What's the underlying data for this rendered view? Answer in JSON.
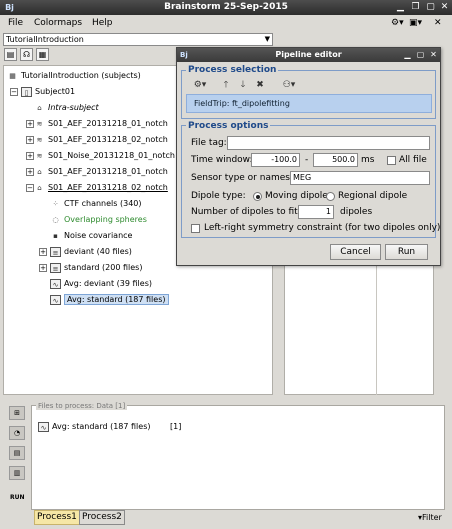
{
  "window": {
    "title": "Brainstorm 25-Sep-2015",
    "app_icon": "Bj"
  },
  "menubar": {
    "items": [
      "File",
      "Colormaps",
      "Help"
    ],
    "right_icons": [
      "gear-icon",
      "layout-icon",
      "close-icon"
    ]
  },
  "protocol": {
    "selected": "TutorialIntroduction"
  },
  "view_toolbar": {
    "buttons": [
      "functional-view-icon",
      "anatomy-view-icon",
      "process-view-icon"
    ]
  },
  "tree": {
    "nodes": [
      {
        "label": "TutorialIntroduction (subjects)",
        "icon": "studies-icon"
      },
      {
        "label": "Subject01",
        "icon": "subject-icon"
      },
      {
        "label": "Intra-subject",
        "icon": "folder-icon"
      },
      {
        "label": "S01_AEF_20131218_01_notch",
        "icon": "raw-icon"
      },
      {
        "label": "S01_AEF_20131218_02_notch",
        "icon": "raw-icon"
      },
      {
        "label": "S01_Noise_20131218_01_notch",
        "icon": "raw-icon"
      },
      {
        "label": "S01_AEF_20131218_01_notch",
        "icon": "folder-icon"
      },
      {
        "label": "S01_AEF_20131218_02_notch",
        "icon": "folder-icon"
      },
      {
        "label": "CTF channels (340)",
        "icon": "channel-icon"
      },
      {
        "label": "Overlapping spheres",
        "icon": "headmodel-icon"
      },
      {
        "label": "Noise covariance",
        "icon": "noisecov-icon"
      },
      {
        "label": "deviant (40 files)",
        "icon": "data-list-icon"
      },
      {
        "label": "standard (200 files)",
        "icon": "data-list-icon"
      },
      {
        "label": "Avg: deviant (39 files)",
        "icon": "data-icon"
      },
      {
        "label": "Avg: standard (187 files)",
        "icon": "data-icon"
      }
    ]
  },
  "process_panel": {
    "legend": "Files to process: Data [1]",
    "file_label": "Avg: standard (187 files)",
    "file_count": "[1]",
    "run_label": "RUN",
    "tabs": [
      "Process1",
      "Process2"
    ],
    "filter_label": "Filter"
  },
  "dialog": {
    "title": "Pipeline editor",
    "selection_title": "Process selection",
    "process_item": "FieldTrip: ft_dipolefitting",
    "options_title": "Process options",
    "file_tag_label": "File tag:",
    "file_tag_value": "",
    "time_window_label": "Time window:",
    "time_start": "-100.0",
    "time_dash": "-",
    "time_end": "500.0",
    "time_unit": "ms",
    "all_file_label": "All file",
    "sensor_label": "Sensor type or names:",
    "sensor_value": "MEG",
    "dipole_type_label": "Dipole type:",
    "moving_dipole_label": "Moving dipole",
    "regional_dipole_label": "Regional dipole",
    "num_dipoles_label": "Number of dipoles to fit:",
    "num_dipoles_value": "1",
    "dipoles_unit": "dipoles",
    "symmetry_label": "Left-right symmetry constraint (for two dipoles only)",
    "cancel_label": "Cancel",
    "run_label": "Run"
  },
  "colors": {
    "title_bar": "#2c2c2c",
    "selection": "#cfe0f4",
    "section_title": "#1f4a8a",
    "process_item_bg": "#b8d0ee",
    "green_text": "#2e8b2e",
    "active_tab": "#f6e7a6"
  }
}
